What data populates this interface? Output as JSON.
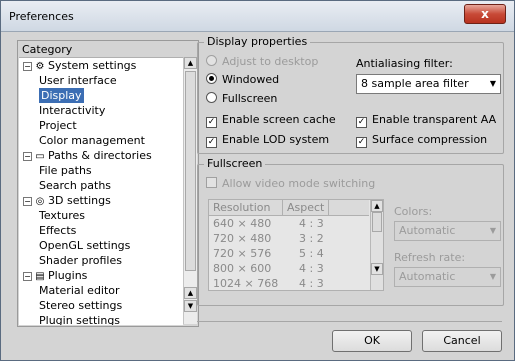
{
  "window": {
    "title": "Preferences",
    "close_label": "x"
  },
  "category": {
    "title": "Category",
    "items": [
      {
        "label": "System settings",
        "level": 0,
        "expander": "−",
        "icon": "⚙"
      },
      {
        "label": "User interface",
        "level": 1
      },
      {
        "label": "Display",
        "level": 1,
        "selected": true
      },
      {
        "label": "Interactivity",
        "level": 1
      },
      {
        "label": "Project",
        "level": 1
      },
      {
        "label": "Color management",
        "level": 1
      },
      {
        "label": "Paths & directories",
        "level": 0,
        "expander": "−",
        "icon": "▭"
      },
      {
        "label": "File paths",
        "level": 1
      },
      {
        "label": "Search paths",
        "level": 1
      },
      {
        "label": "3D settings",
        "level": 0,
        "expander": "−",
        "icon": "◎"
      },
      {
        "label": "Textures",
        "level": 1
      },
      {
        "label": "Effects",
        "level": 1
      },
      {
        "label": "OpenGL settings",
        "level": 1
      },
      {
        "label": "Shader profiles",
        "level": 1
      },
      {
        "label": "Plugins",
        "level": 0,
        "expander": "−",
        "icon": "▤"
      },
      {
        "label": "Material editor",
        "level": 1
      },
      {
        "label": "Stereo settings",
        "level": 1
      },
      {
        "label": "Plugin settings",
        "level": 1
      }
    ]
  },
  "display_properties": {
    "title": "Display properties",
    "adjust_to_desktop": "Adjust to desktop",
    "windowed": "Windowed",
    "fullscreen": "Fullscreen",
    "antialiasing_label": "Antialiasing filter:",
    "antialiasing_value": "8 sample area filter",
    "enable_screen_cache": "Enable screen cache",
    "enable_lod_system": "Enable LOD system",
    "enable_transparent_aa": "Enable transparent AA",
    "surface_compression": "Surface compression",
    "check_mark": "✓"
  },
  "fullscreen": {
    "title": "Fullscreen",
    "allow_video_mode_switching": "Allow video mode switching",
    "col_resolution": "Resolution",
    "col_aspect": "Aspect",
    "rows": [
      {
        "resolution": "640 × 480",
        "aspect": "4 : 3"
      },
      {
        "resolution": "720 × 480",
        "aspect": "3 : 2"
      },
      {
        "resolution": "720 × 576",
        "aspect": "5 : 4"
      },
      {
        "resolution": "800 × 600",
        "aspect": "4 : 3"
      },
      {
        "resolution": "1024 × 768",
        "aspect": "4 : 3"
      }
    ],
    "colors_label": "Colors:",
    "colors_value": "Automatic",
    "refresh_label": "Refresh rate:",
    "refresh_value": "Automatic"
  },
  "buttons": {
    "ok": "OK",
    "cancel": "Cancel"
  }
}
